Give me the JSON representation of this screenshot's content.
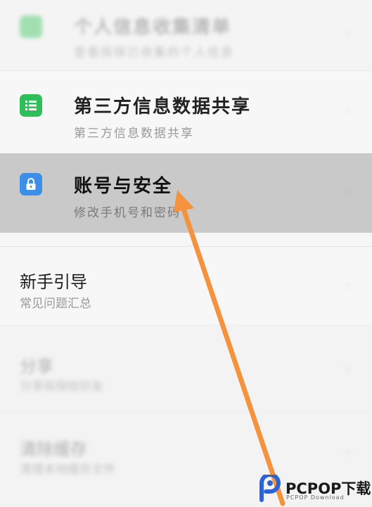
{
  "rows": [
    {
      "title": "个人信息收集清单",
      "subtitle": "查看探探已收集的个人信息"
    },
    {
      "title": "第三方信息数据共享",
      "subtitle": "第三方信息数据共享"
    },
    {
      "title": "账号与安全",
      "subtitle": "修改手机号和密码"
    },
    {
      "title": "新手引导",
      "subtitle": "常见问题汇总"
    },
    {
      "title": "分享",
      "subtitle": "分享探探给好友"
    },
    {
      "title": "清除缓存",
      "subtitle": "清理本地缓存文件"
    }
  ],
  "watermark": {
    "brand": "PCPOP下载",
    "sub": "PCPOP Download"
  },
  "colors": {
    "green": "#2fbf5a",
    "blue": "#3b8fe8",
    "arrow": "#f5923e"
  }
}
